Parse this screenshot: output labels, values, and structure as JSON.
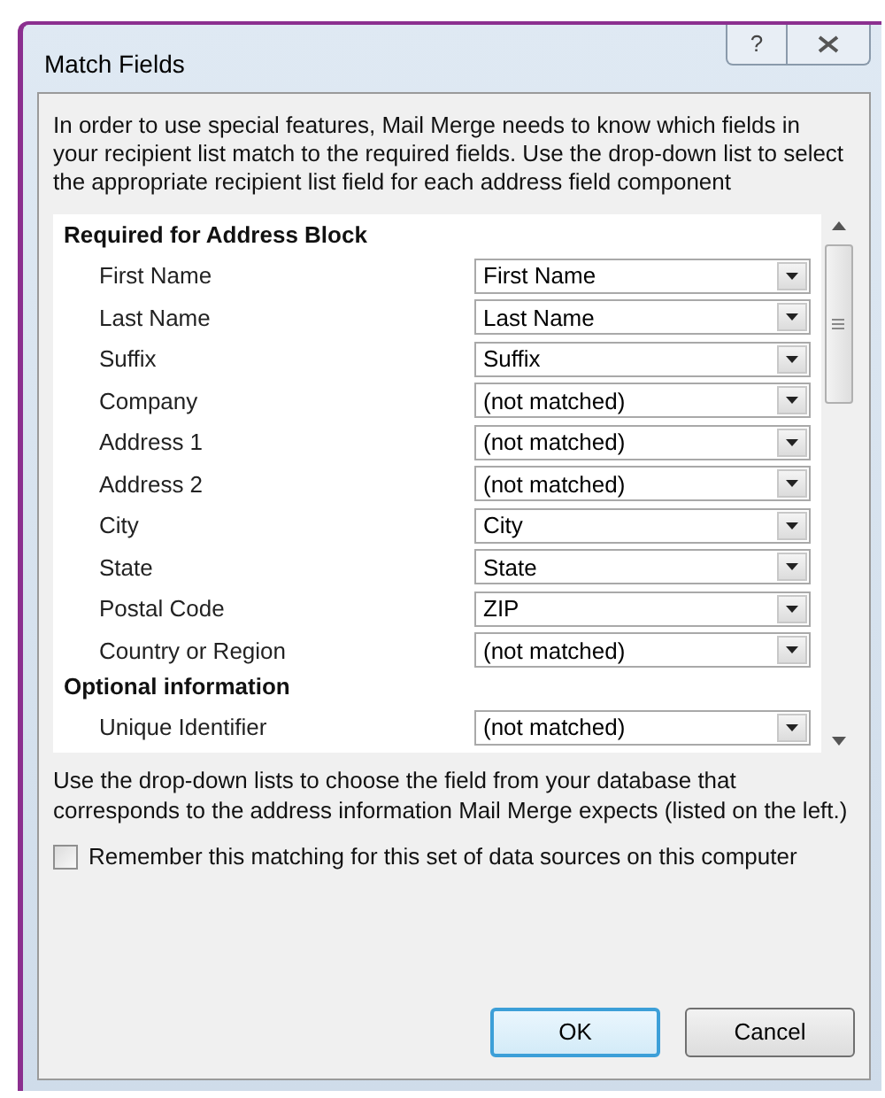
{
  "window": {
    "title": "Match Fields",
    "help_button": "?"
  },
  "intro": "In order to use special features, Mail Merge needs to know which fields in your recipient list match to the required fields.  Use the drop-down list to select the appropriate recipient list field for each address field component",
  "sections": [
    {
      "heading": "Required for Address Block",
      "fields": [
        {
          "label": "First Name",
          "value": "First Name"
        },
        {
          "label": "Last Name",
          "value": "Last Name"
        },
        {
          "label": "Suffix",
          "value": "Suffix"
        },
        {
          "label": "Company",
          "value": "(not matched)"
        },
        {
          "label": "Address 1",
          "value": "(not matched)"
        },
        {
          "label": "Address 2",
          "value": "(not matched)"
        },
        {
          "label": "City",
          "value": "City"
        },
        {
          "label": "State",
          "value": "State"
        },
        {
          "label": "Postal Code",
          "value": "ZIP"
        },
        {
          "label": "Country or Region",
          "value": "(not matched)"
        }
      ]
    },
    {
      "heading": "Optional information",
      "fields": [
        {
          "label": "Unique Identifier",
          "value": "(not matched)"
        }
      ]
    }
  ],
  "hint": "Use the drop-down lists to choose the field from your database that corresponds to the address information Mail Merge expects (listed on the left.)",
  "remember": {
    "label": "Remember this matching for this set of data sources on this computer",
    "checked": false
  },
  "buttons": [
    {
      "label": "OK",
      "default": true
    },
    {
      "label": "Cancel",
      "default": false
    }
  ]
}
